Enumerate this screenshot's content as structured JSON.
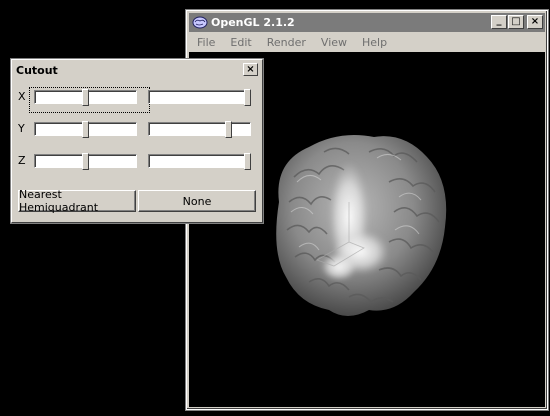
{
  "main_window": {
    "title": "OpenGL 2.1.2",
    "icon": "brain-logo-icon",
    "controls": {
      "minimize": "_",
      "maximize": "□",
      "close": "×"
    },
    "menu": [
      "File",
      "Edit",
      "Render",
      "View",
      "Help"
    ]
  },
  "cutout": {
    "title": "Cutout",
    "close": "×",
    "rows": [
      {
        "axis": "X",
        "left_slider": 0.5,
        "right_slider": 1.0
      },
      {
        "axis": "Y",
        "left_slider": 0.5,
        "right_slider": 0.8
      },
      {
        "axis": "Z",
        "left_slider": 0.5,
        "right_slider": 1.0
      }
    ],
    "buttons": {
      "left": "Nearest Hemiquadrant",
      "right": "None"
    }
  },
  "colors": {
    "title_inactive": "#7b7b7b",
    "face": "#d4d0c8",
    "canvas": "#000000"
  }
}
